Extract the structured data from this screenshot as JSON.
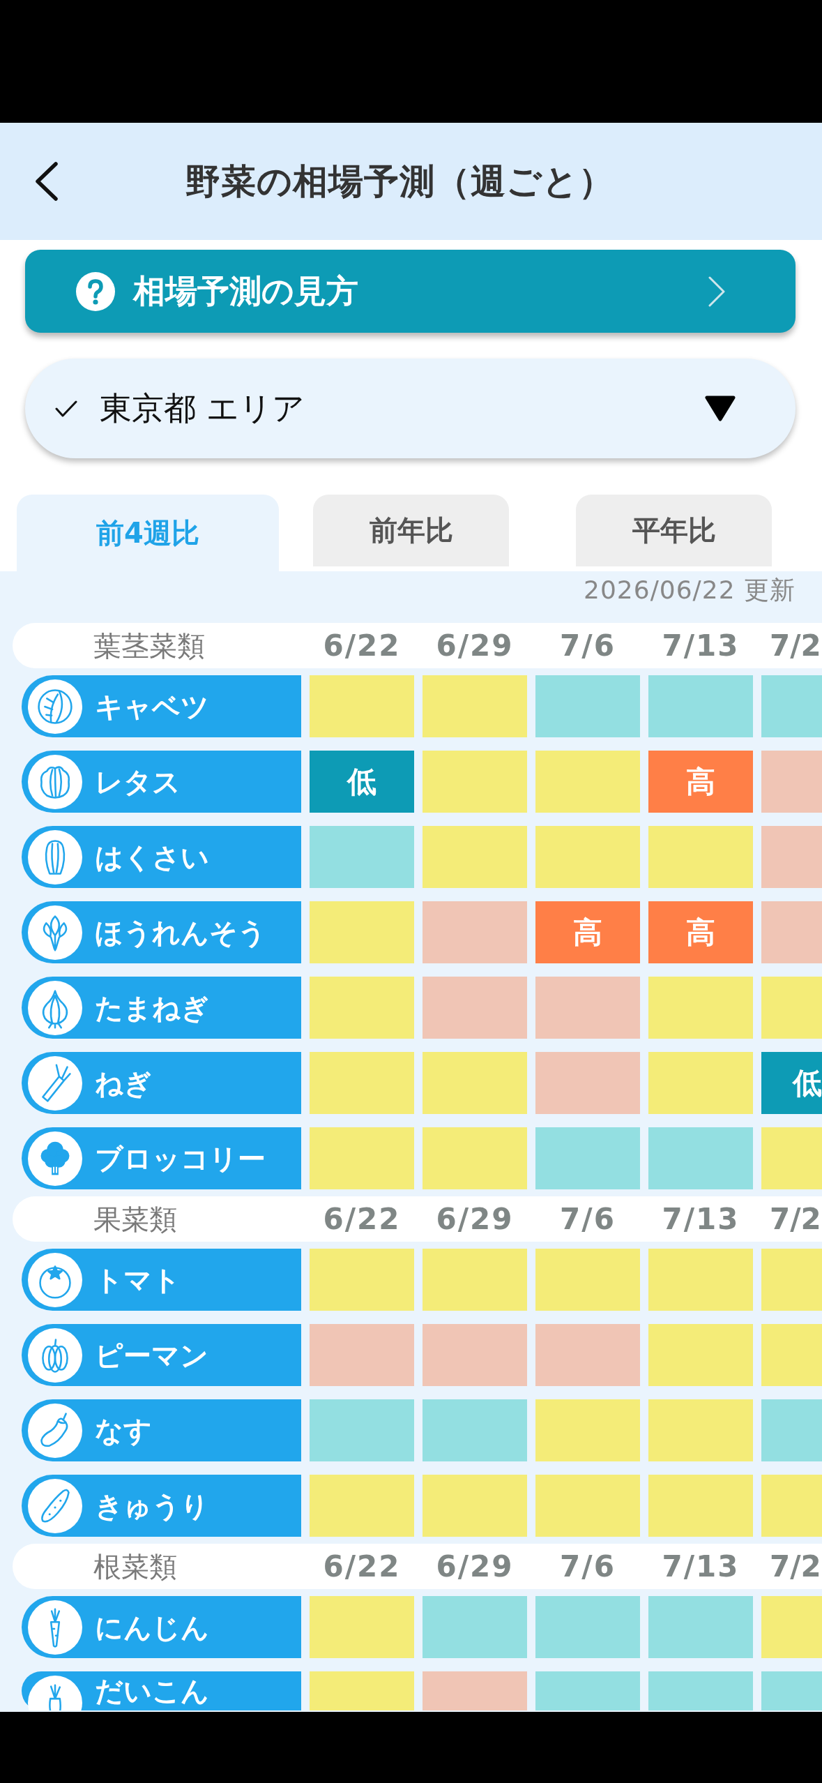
{
  "header": {
    "title": "野菜の相場予測（週ごと）"
  },
  "help_button": {
    "label": "相場予測の見方"
  },
  "area_select": {
    "value": "東京都 エリア"
  },
  "tabs": [
    {
      "label": "前4週比",
      "selected": true
    },
    {
      "label": "前年比",
      "selected": false
    },
    {
      "label": "平年比",
      "selected": false
    }
  ],
  "updated": "2026/06/22 更新",
  "sections": [
    {
      "category": "葉茎菜類",
      "dates": [
        "6/22",
        "6/29",
        "7/6",
        "7/13",
        "7/2"
      ],
      "rows": [
        {
          "name": "キャベツ",
          "cells": [
            {
              "color": "#f4ec78"
            },
            {
              "color": "#f4ec78"
            },
            {
              "color": "#93dfe1"
            },
            {
              "color": "#93dfe1"
            },
            {
              "color": "#93dfe1"
            }
          ]
        },
        {
          "name": "レタス",
          "cells": [
            {
              "color": "#0d9bb5",
              "label": "低"
            },
            {
              "color": "#f4ec78"
            },
            {
              "color": "#f4ec78"
            },
            {
              "color": "#ff7f47",
              "label": "高"
            },
            {
              "color": "#f0c5b5"
            }
          ]
        },
        {
          "name": "はくさい",
          "cells": [
            {
              "color": "#93dfe1"
            },
            {
              "color": "#f4ec78"
            },
            {
              "color": "#f4ec78"
            },
            {
              "color": "#f4ec78"
            },
            {
              "color": "#f0c5b5"
            }
          ]
        },
        {
          "name": "ほうれんそう",
          "cells": [
            {
              "color": "#f4ec78"
            },
            {
              "color": "#f0c5b5"
            },
            {
              "color": "#ff7f47",
              "label": "高"
            },
            {
              "color": "#ff7f47",
              "label": "高"
            },
            {
              "color": "#f0c5b5"
            }
          ]
        },
        {
          "name": "たまねぎ",
          "cells": [
            {
              "color": "#f4ec78"
            },
            {
              "color": "#f0c5b5"
            },
            {
              "color": "#f0c5b5"
            },
            {
              "color": "#f4ec78"
            },
            {
              "color": "#f4ec78"
            }
          ]
        },
        {
          "name": "ねぎ",
          "cells": [
            {
              "color": "#f4ec78"
            },
            {
              "color": "#f4ec78"
            },
            {
              "color": "#f0c5b5"
            },
            {
              "color": "#f4ec78"
            },
            {
              "color": "#0d9bb5",
              "label": "低"
            }
          ]
        },
        {
          "name": "ブロッコリー",
          "cells": [
            {
              "color": "#f4ec78"
            },
            {
              "color": "#f4ec78"
            },
            {
              "color": "#93dfe1"
            },
            {
              "color": "#93dfe1"
            },
            {
              "color": "#f4ec78"
            }
          ]
        }
      ]
    },
    {
      "category": "果菜類",
      "dates": [
        "6/22",
        "6/29",
        "7/6",
        "7/13",
        "7/2"
      ],
      "rows": [
        {
          "name": "トマト",
          "cells": [
            {
              "color": "#f4ec78"
            },
            {
              "color": "#f4ec78"
            },
            {
              "color": "#f4ec78"
            },
            {
              "color": "#f4ec78"
            },
            {
              "color": "#f4ec78"
            }
          ]
        },
        {
          "name": "ピーマン",
          "cells": [
            {
              "color": "#f0c5b5"
            },
            {
              "color": "#f0c5b5"
            },
            {
              "color": "#f0c5b5"
            },
            {
              "color": "#f4ec78"
            },
            {
              "color": "#f4ec78"
            }
          ]
        },
        {
          "name": "なす",
          "cells": [
            {
              "color": "#93dfe1"
            },
            {
              "color": "#93dfe1"
            },
            {
              "color": "#f4ec78"
            },
            {
              "color": "#f4ec78"
            },
            {
              "color": "#93dfe1"
            }
          ]
        },
        {
          "name": "きゅうり",
          "cells": [
            {
              "color": "#f4ec78"
            },
            {
              "color": "#f4ec78"
            },
            {
              "color": "#f4ec78"
            },
            {
              "color": "#f4ec78"
            },
            {
              "color": "#f4ec78"
            }
          ]
        }
      ]
    },
    {
      "category": "根菜類",
      "dates": [
        "6/22",
        "6/29",
        "7/6",
        "7/13",
        "7/2"
      ],
      "rows": [
        {
          "name": "にんじん",
          "cells": [
            {
              "color": "#f4ec78"
            },
            {
              "color": "#93dfe1"
            },
            {
              "color": "#93dfe1"
            },
            {
              "color": "#93dfe1"
            },
            {
              "color": "#f4ec78"
            }
          ]
        },
        {
          "name": "だいこん",
          "cells": [
            {
              "color": "#f4ec78"
            },
            {
              "color": "#f0c5b5"
            },
            {
              "color": "#93dfe1"
            },
            {
              "color": "#93dfe1"
            },
            {
              "color": "#93dfe1"
            }
          ]
        }
      ]
    }
  ]
}
